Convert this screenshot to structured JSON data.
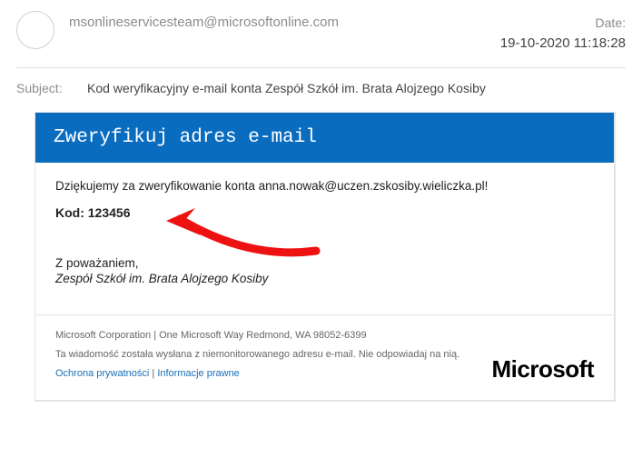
{
  "header": {
    "from": "msonlineservicesteam@microsoftonline.com",
    "date_label": "Date:",
    "date_value": "19-10-2020 11:18:28"
  },
  "subject": {
    "label": "Subject:",
    "text": "Kod weryfikacyjny e-mail konta Zespół Szkół im. Brata Alojzego Kosiby"
  },
  "body": {
    "banner": "Zweryfikuj adres e-mail",
    "thanks": "Dziękujemy za zweryfikowanie konta anna.nowak@uczen.zskosiby.wieliczka.pl!",
    "code_label": "Kod: ",
    "code_value": "123456",
    "regards": "Z poważaniem,",
    "team": "Zespół Szkół im. Brata Alojzego Kosiby"
  },
  "footer": {
    "corp": "Microsoft Corporation | One Microsoft Way Redmond, WA 98052-6399",
    "disclaimer": "Ta wiadomość została wysłana z niemonitorowanego adresu e-mail. Nie odpowiadaj na nią.",
    "link_privacy": "Ochrona prywatności",
    "link_sep": " | ",
    "link_legal": "Informacje prawne",
    "logo": "Microsoft"
  }
}
